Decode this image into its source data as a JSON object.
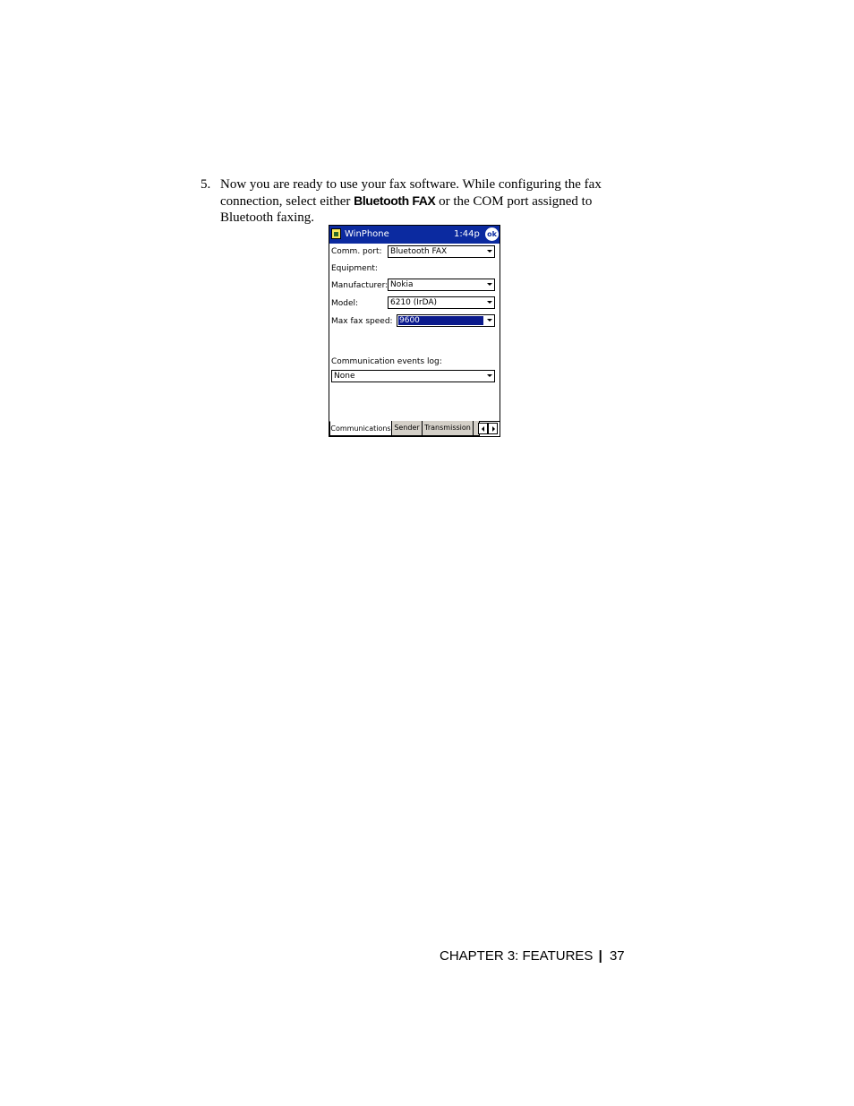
{
  "step": {
    "number": "5.",
    "text_before": "Now you are ready to use your fax software. While configuring the fax connection, select either ",
    "ui_label": "Bluetooth FAX",
    "text_after": " or the COM port assigned to Bluetooth faxing."
  },
  "screen": {
    "app_icon": "winphone-app-icon",
    "title": "WinPhone",
    "time": "1:44p",
    "ok_label": "ok",
    "fields": {
      "comm_port": {
        "label": "Comm. port:",
        "value": "Bluetooth FAX"
      },
      "equipment": {
        "label": "Equipment:"
      },
      "manufacturer": {
        "label": "Manufacturer:",
        "value": "Nokia"
      },
      "model": {
        "label": "Model:",
        "value": "6210 (IrDA)"
      },
      "max_fax_speed": {
        "label": "Max fax speed:",
        "value": "9600"
      },
      "events_log": {
        "label": "Communication events log:",
        "value": "None"
      }
    },
    "tabs": [
      "Communications",
      "Sender",
      "Transmission"
    ],
    "active_tab": "Communications"
  },
  "footer": {
    "chapter": "CHAPTER 3: FEATURES",
    "separator": "|",
    "page": "37"
  }
}
